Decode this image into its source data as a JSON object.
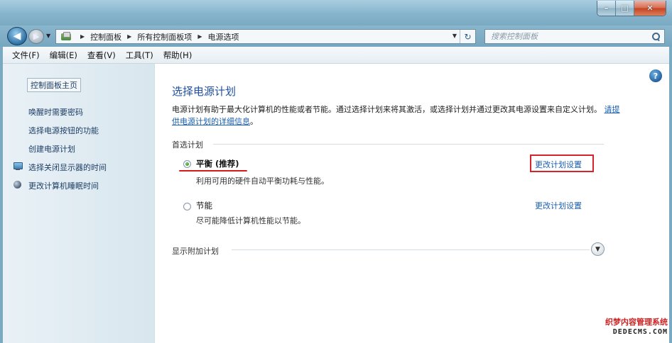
{
  "window": {
    "minimize_glyph": "–",
    "maximize_glyph": "□",
    "close_glyph": "✕"
  },
  "address_bar": {
    "crumbs": [
      "控制面板",
      "所有控制面板项",
      "电源选项"
    ],
    "refresh_glyph": "↻"
  },
  "search": {
    "placeholder": "搜索控制面板"
  },
  "menu": {
    "items": [
      "文件(F)",
      "编辑(E)",
      "查看(V)",
      "工具(T)",
      "帮助(H)"
    ]
  },
  "sidebar": {
    "home": "控制面板主页",
    "links": [
      "唤醒时需要密码",
      "选择电源按钮的功能",
      "创建电源计划",
      "选择关闭显示器的时间",
      "更改计算机睡眠时间"
    ]
  },
  "main": {
    "title": "选择电源计划",
    "description": "电源计划有助于最大化计算机的性能或者节能。通过选择计划来将其激活，或选择计划并通过更改其电源设置来自定义计划。",
    "description_link": "请提供电源计划的详细信息",
    "description_end": "。",
    "preferred_label": "首选计划",
    "plans": [
      {
        "name": "平衡 (推荐)",
        "description": "利用可用的硬件自动平衡功耗与性能。",
        "change_link": "更改计划设置",
        "selected": true
      },
      {
        "name": "节能",
        "description": "尽可能降低计算机性能以节能。",
        "change_link": "更改计划设置",
        "selected": false
      }
    ],
    "show_additional": "显示附加计划",
    "help_glyph": "?"
  },
  "watermark": {
    "line1": "织梦内容管理系统",
    "line2": "DEDECMS.COM"
  },
  "colors": {
    "link": "#1a5fb4",
    "title": "#1e4fa0",
    "highlight": "#d4242a"
  }
}
